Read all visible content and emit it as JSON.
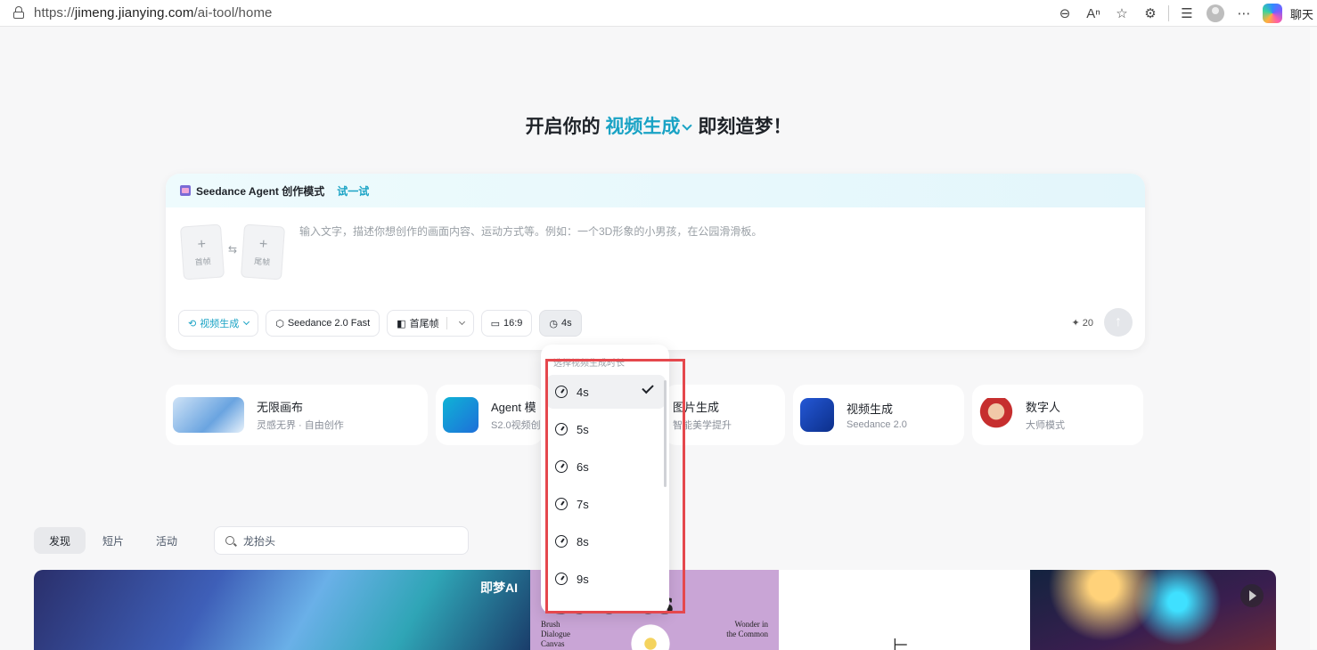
{
  "browser": {
    "url_prefix": "https://",
    "url_host": "jimeng.jianying.com",
    "url_path": "/ai-tool/home",
    "chat_label": "聊天"
  },
  "headline": {
    "before": "开启你的",
    "accent": "视频生成",
    "after": "即刻造梦！"
  },
  "composer": {
    "agent_label": "Seedance Agent 创作模式",
    "agent_try": "试一试",
    "first_frame": "首帧",
    "last_frame": "尾帧",
    "prompt_placeholder": "输入文字，描述你想创作的画面内容、运动方式等。例如：一个3D形象的小男孩，在公园滑滑板。",
    "mode": "视频生成",
    "model": "Seedance 2.0 Fast",
    "frames_mode": "首尾帧",
    "ratio": "16:9",
    "duration": "4s",
    "credits": "20"
  },
  "features": [
    {
      "title": "无限画布",
      "subtitle": "灵感无界 · 自由创作"
    },
    {
      "title": "Agent 模",
      "subtitle": "S2.0视频创"
    },
    {
      "title": "图片生成",
      "subtitle": "智能美学提升"
    },
    {
      "title": "视频生成",
      "subtitle": "Seedance 2.0"
    },
    {
      "title": "数字人",
      "subtitle": "大师模式"
    }
  ],
  "tabs": [
    "发现",
    "短片",
    "活动"
  ],
  "search_value": "龙抬头",
  "gallery": {
    "g1_logo": "即梦AI",
    "g2_title": "Strokes",
    "g2_left": [
      "Brush",
      "Dialogue",
      "Canvas"
    ],
    "g2_right": [
      "Wonder in",
      "the Common"
    ]
  },
  "dropdown": {
    "title": "选择视频生成时长",
    "options": [
      "4s",
      "5s",
      "6s",
      "7s",
      "8s",
      "9s"
    ],
    "selected": "4s"
  },
  "colors": {
    "accent": "#1aa3c5",
    "highlight": "#e5484d"
  }
}
